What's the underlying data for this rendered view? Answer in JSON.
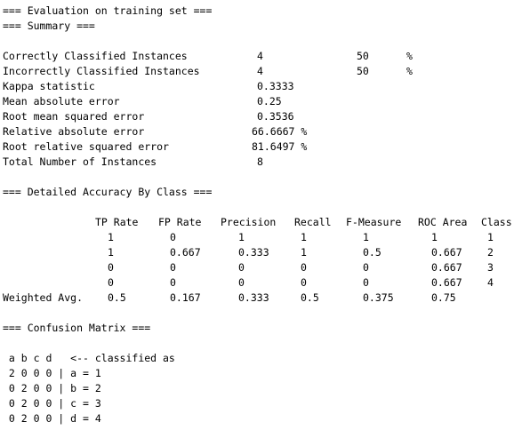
{
  "header": {
    "title": "=== Evaluation on training set ===",
    "summary_heading": "=== Summary ==="
  },
  "summary": {
    "correct": {
      "label": "Correctly Classified Instances",
      "count": "4",
      "percent": "50",
      "pct_sign": "%"
    },
    "incorrect": {
      "label": "Incorrectly Classified Instances",
      "count": "4",
      "percent": "50",
      "pct_sign": "%"
    },
    "kappa": {
      "label": "Kappa statistic",
      "value": "0.3333"
    },
    "mae": {
      "label": "Mean absolute error",
      "value": "0.25"
    },
    "rmse": {
      "label": "Root mean squared error",
      "value": "0.3536"
    },
    "rae": {
      "label": "Relative absolute error",
      "value": "66.6667 %"
    },
    "rrse": {
      "label": "Root relative squared error",
      "value": "81.6497 %"
    },
    "total": {
      "label": "Total Number of Instances",
      "value": "8"
    }
  },
  "accuracy": {
    "heading": "=== Detailed Accuracy By Class ===",
    "headers": [
      "TP Rate",
      "FP Rate",
      "Precision",
      "Recall",
      "F-Measure",
      "ROC Area",
      "Class"
    ],
    "rows": [
      [
        "1",
        "0",
        "1",
        "1",
        "1",
        "1",
        "1"
      ],
      [
        "1",
        "0.667",
        "0.333",
        "1",
        "0.5",
        "0.667",
        "2"
      ],
      [
        "0",
        "0",
        "0",
        "0",
        "0",
        "0.667",
        "3"
      ],
      [
        "0",
        "0",
        "0",
        "0",
        "0",
        "0.667",
        "4"
      ]
    ],
    "weighted_label": "Weighted Avg.",
    "weighted": [
      "0.5",
      "0.167",
      "0.333",
      "0.5",
      "0.375",
      "0.75"
    ]
  },
  "confusion": {
    "heading": "=== Confusion Matrix ===",
    "header_line": " a b c d   <-- classified as",
    "rows": [
      " 2 0 0 0 | a = 1",
      " 0 2 0 0 | b = 2",
      " 0 2 0 0 | c = 3",
      " 0 2 0 0 | d = 4"
    ]
  }
}
